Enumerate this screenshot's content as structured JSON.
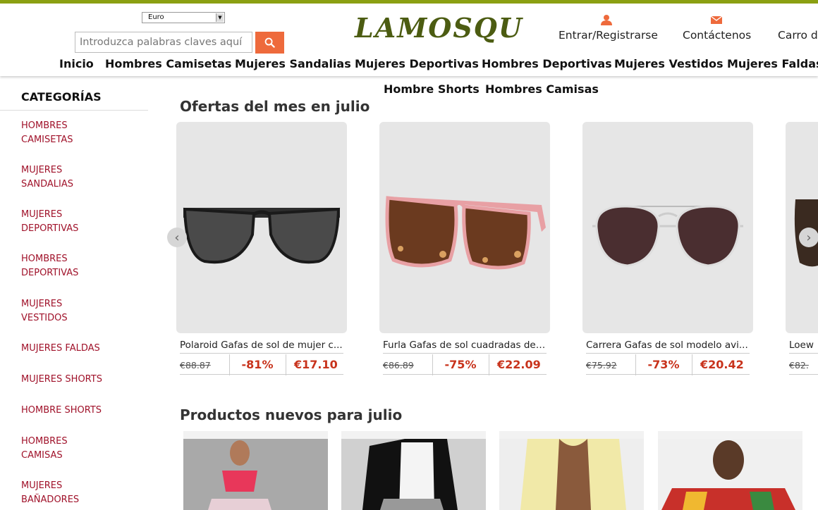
{
  "header": {
    "currency": "Euro",
    "search_placeholder": "Introduzca palabras claves aquí",
    "logo": "LAMOSQU",
    "login_label": "Entrar/Registrarse",
    "contact_label": "Contáctenos",
    "cart_label": "Carro d"
  },
  "nav": {
    "row1": [
      "Inicio",
      "Hombres Camisetas",
      "Mujeres Sandalias",
      "Mujeres Deportivas",
      "Hombres Deportivas",
      "Mujeres Vestidos",
      "Mujeres Faldas"
    ],
    "row2": [
      "Hombre Shorts",
      "Hombres Camisas"
    ]
  },
  "sidebar": {
    "title": "CATEGORÍAS",
    "items": [
      {
        "line1": "HOMBRES",
        "line2": "CAMISETAS"
      },
      {
        "line1": "MUJERES",
        "line2": "SANDALIAS"
      },
      {
        "line1": "MUJERES",
        "line2": "DEPORTIVAS"
      },
      {
        "line1": "HOMBRES",
        "line2": "DEPORTIVAS"
      },
      {
        "line1": "MUJERES",
        "line2": "VESTIDOS"
      },
      {
        "line1": "MUJERES FALDAS",
        "line2": ""
      },
      {
        "line1": "MUJERES SHORTS",
        "line2": ""
      },
      {
        "line1": "HOMBRE SHORTS",
        "line2": ""
      },
      {
        "line1": "HOMBRES",
        "line2": "CAMISAS"
      },
      {
        "line1": "MUJERES",
        "line2": "BAÑADORES"
      }
    ]
  },
  "deals": {
    "title": "Ofertas del mes en julio",
    "products": [
      {
        "title": "Polaroid Gafas de sol de mujer c...",
        "old_price": "€88.87",
        "discount": "-81%",
        "price": "€17.10"
      },
      {
        "title": "Furla Gafas de sol cuadradas de ...",
        "old_price": "€86.89",
        "discount": "-75%",
        "price": "€22.09"
      },
      {
        "title": "Carrera Gafas de sol modelo avi...",
        "old_price": "€75.92",
        "discount": "-73%",
        "price": "€20.42"
      },
      {
        "title": "Loew",
        "old_price": "€82.",
        "discount": "",
        "price": ""
      }
    ]
  },
  "new_products": {
    "title": "Productos nuevos para julio"
  },
  "colors": {
    "accent_bar": "#8ba012",
    "logo": "#4c5c12",
    "search_button": "#ee6a3c",
    "category_link": "#a0122a",
    "price": "#c8331c"
  }
}
